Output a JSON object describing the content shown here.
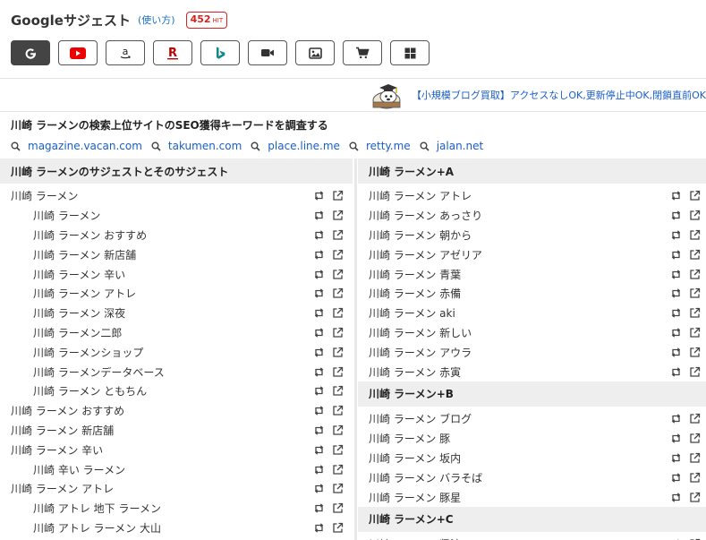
{
  "header": {
    "title": "Googleサジェスト",
    "howto": "(使い方)",
    "hit_count": "452",
    "hit_label": "HIT"
  },
  "engines": [
    {
      "name": "google",
      "icon": "google-g-icon",
      "active": true
    },
    {
      "name": "youtube",
      "icon": "youtube-icon",
      "active": false
    },
    {
      "name": "amazon",
      "icon": "amazon-icon",
      "active": false
    },
    {
      "name": "rakuten",
      "icon": "rakuten-icon",
      "active": false
    },
    {
      "name": "bing",
      "icon": "bing-icon",
      "active": false
    },
    {
      "name": "video",
      "icon": "video-camera-icon",
      "active": false
    },
    {
      "name": "image",
      "icon": "image-icon",
      "active": false
    },
    {
      "name": "shopping",
      "icon": "cart-icon",
      "active": false
    },
    {
      "name": "apps",
      "icon": "grid-icon",
      "active": false
    }
  ],
  "ad": {
    "text": "【小規模ブログ買取】アクセスなしOK,更新停止中OK,閉鎖直前OK"
  },
  "research": {
    "title": "川崎 ラーメンの検索上位サイトのSEO獲得キーワードを調査する",
    "sites": [
      "magazine.vacan.com",
      "takumen.com",
      "place.line.me",
      "retty.me",
      "jalan.net"
    ]
  },
  "left": {
    "heading": "川崎 ラーメンのサジェストとそのサジェスト",
    "rows": [
      {
        "text": "川崎 ラーメン",
        "child": false
      },
      {
        "text": "川崎 ラーメン",
        "child": true
      },
      {
        "text": "川崎 ラーメン おすすめ",
        "child": true
      },
      {
        "text": "川崎 ラーメン 新店舗",
        "child": true
      },
      {
        "text": "川崎 ラーメン 辛い",
        "child": true
      },
      {
        "text": "川崎 ラーメン アトレ",
        "child": true
      },
      {
        "text": "川崎 ラーメン 深夜",
        "child": true
      },
      {
        "text": "川崎 ラーメン二郎",
        "child": true
      },
      {
        "text": "川崎 ラーメンショップ",
        "child": true
      },
      {
        "text": "川崎 ラーメンデータベース",
        "child": true
      },
      {
        "text": "川崎 ラーメン ともちん",
        "child": true
      },
      {
        "text": "川崎 ラーメン おすすめ",
        "child": false
      },
      {
        "text": "川崎 ラーメン 新店舗",
        "child": false
      },
      {
        "text": "川崎 ラーメン 辛い",
        "child": false
      },
      {
        "text": "川崎 辛い ラーメン",
        "child": true
      },
      {
        "text": "川崎 ラーメン アトレ",
        "child": false
      },
      {
        "text": "川崎 アトレ 地下 ラーメン",
        "child": true
      },
      {
        "text": "川崎 アトレ ラーメン 大山",
        "child": true
      }
    ]
  },
  "right": {
    "sections": [
      {
        "heading": "川崎 ラーメン+A",
        "rows": [
          "川崎 ラーメン アトレ",
          "川崎 ラーメン あっさり",
          "川崎 ラーメン 朝から",
          "川崎 ラーメン アゼリア",
          "川崎 ラーメン 青葉",
          "川崎 ラーメン 赤備",
          "川崎 ラーメン aki",
          "川崎 ラーメン 新しい",
          "川崎 ラーメン アウラ",
          "川崎 ラーメン 赤寅"
        ]
      },
      {
        "heading": "川崎 ラーメン+B",
        "rows": [
          "川崎 ラーメン ブログ",
          "川崎 ラーメン 豚",
          "川崎 ラーメン 坂内",
          "川崎 ラーメン バラそば",
          "川崎 ラーメン 豚星"
        ]
      },
      {
        "heading": "川崎 ラーメン+C",
        "rows": [
          "川崎 ラーメン 醤油"
        ]
      }
    ]
  }
}
